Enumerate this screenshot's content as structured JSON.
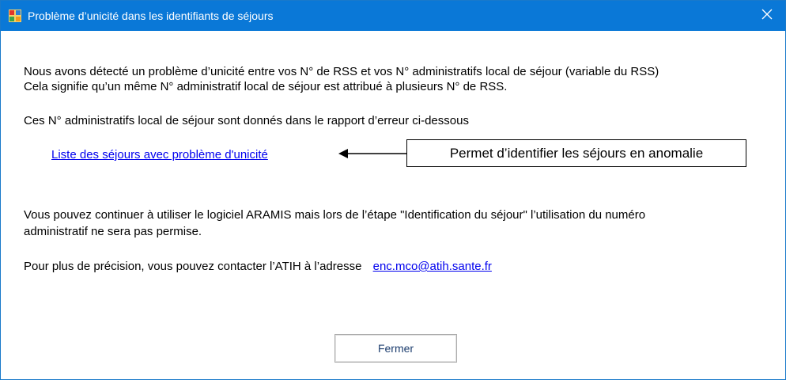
{
  "window": {
    "title": "Problème d’unicité dans les identifiants de séjours",
    "close_glyph": "✕",
    "titlebar_color": "#0a78d7"
  },
  "message": {
    "line1": "Nous avons détecté un problème d’unicité entre vos N° de RSS et vos N° administratifs local de séjour (variable du RSS)",
    "line2": "Cela signifie qu’un même N° administratif local de séjour est attribué à plusieurs N° de RSS.",
    "line3": "Ces N° administratifs local de séjour sont donnés dans le rapport d’erreur ci-dessous",
    "report_link": "Liste des séjours avec problème d'unicité",
    "callout": "Permet d’identifier les séjours en anomalie",
    "line4": "Vous pouvez continuer à utiliser le logiciel ARAMIS mais lors de l’étape \"Identification du séjour\" l’utilisation du numéro",
    "line5": "administratif ne sera pas permise.",
    "contact_text": "Pour plus de précision, vous pouvez contacter l’ATIH à l’adresse",
    "contact_email": "enc.mco@atih.sante.fr",
    "link_color": "#0000ee"
  },
  "buttons": {
    "close_label": "Fermer"
  }
}
